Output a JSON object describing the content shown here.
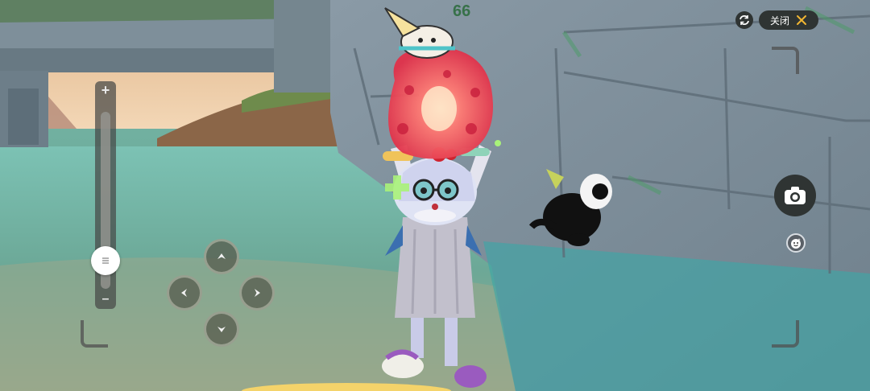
{
  "top_bar": {
    "close_label": "关闭",
    "refresh_icon": "refresh-icon",
    "close_icon": "x-icon"
  },
  "camera": {
    "shutter_icon": "camera-icon",
    "emote_icon": "smiley-face-icon"
  },
  "zoom_slider": {
    "plus_label": "+",
    "minus_label": "–",
    "handle_icon": "drag-handle-icon",
    "level": 0.12
  },
  "dpad": {
    "up_icon": "chevron-up-icon",
    "down_icon": "chevron-down-icon",
    "left_icon": "chevron-left-icon",
    "right_icon": "chevron-right-icon"
  },
  "colors": {
    "accent": "#f2b632",
    "hud_dark": "#2f3433",
    "sea": "#6fb0a3"
  }
}
